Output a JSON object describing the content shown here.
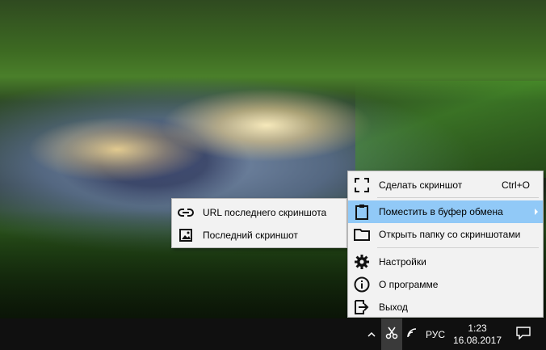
{
  "menu": {
    "items": [
      {
        "label": "Сделать скриншот",
        "shortcut": "Ctrl+O",
        "icon": "screenshot-frame-icon"
      },
      {
        "label": "Поместить в буфер обмена",
        "icon": "clipboard-icon",
        "has_submenu": true,
        "active": true
      },
      {
        "label": "Открыть папку со скриншотами",
        "icon": "folder-icon"
      },
      {
        "label": "Настройки",
        "icon": "gear-icon"
      },
      {
        "label": "О программе",
        "icon": "info-icon"
      },
      {
        "label": "Выход",
        "icon": "exit-icon"
      }
    ],
    "highlight_color": "#91c9f7"
  },
  "submenu": {
    "items": [
      {
        "label": "URL последнего скриншота",
        "icon": "link-icon"
      },
      {
        "label": "Последний скриншот",
        "icon": "image-icon"
      }
    ]
  },
  "taskbar": {
    "language": "РУС",
    "time": "1:23",
    "date": "16.08.2017",
    "tray_icons": [
      "chevron-up-icon",
      "scissors-icon",
      "wifi-icon",
      "notification-icon"
    ]
  }
}
